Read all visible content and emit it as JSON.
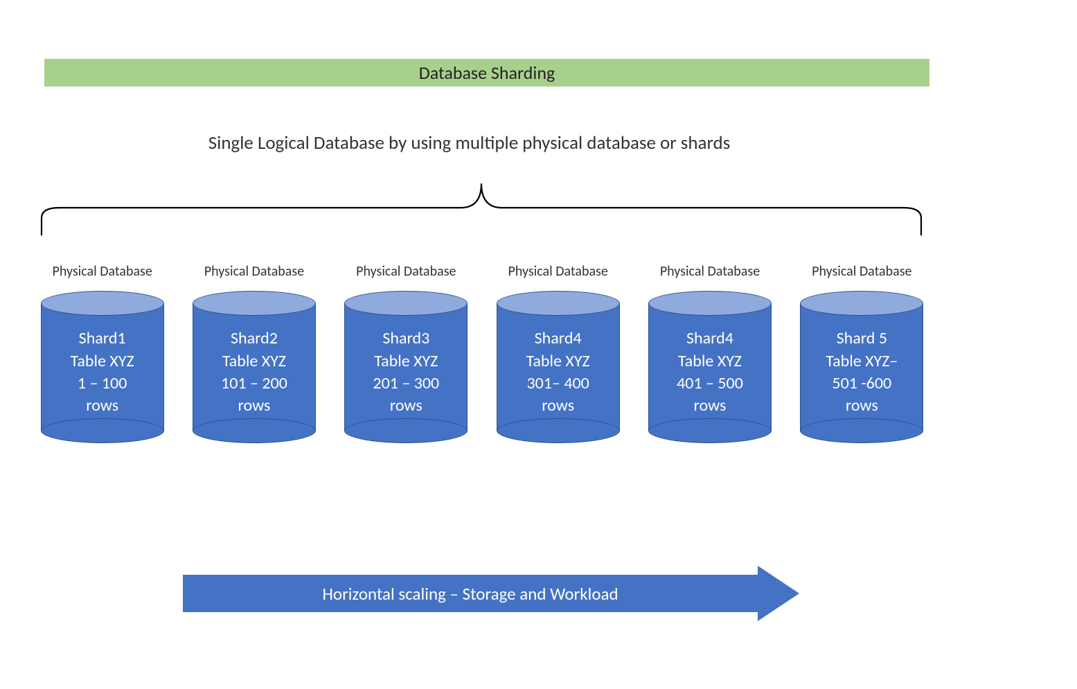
{
  "title": "Database Sharding",
  "subtitle": "Single Logical Database by using multiple physical database or shards",
  "physical_label": "Physical Database",
  "shards": [
    {
      "name": "Shard1",
      "table": "Table XYZ",
      "range": "1 – 100",
      "rows": "rows"
    },
    {
      "name": "Shard2",
      "table": "Table XYZ",
      "range": "101 – 200",
      "rows": "rows"
    },
    {
      "name": "Shard3",
      "table": "Table  XYZ",
      "range": "201 – 300",
      "rows": "rows"
    },
    {
      "name": "Shard4",
      "table": "Table XYZ",
      "range": "301– 400",
      "rows": "rows"
    },
    {
      "name": "Shard4",
      "table": "Table XYZ",
      "range": "401 – 500",
      "rows": "rows"
    },
    {
      "name": "Shard 5",
      "table": "Table XYZ–",
      "range": "501 -600",
      "rows": "rows"
    }
  ],
  "arrow_label": "Horizontal scaling – Storage and Workload",
  "colors": {
    "title_bg": "#a8d08d",
    "cylinder_fill": "#4472c4",
    "cylinder_top": "#8faadc",
    "cylinder_stroke": "#2f528f",
    "arrow_fill": "#4472c4"
  }
}
